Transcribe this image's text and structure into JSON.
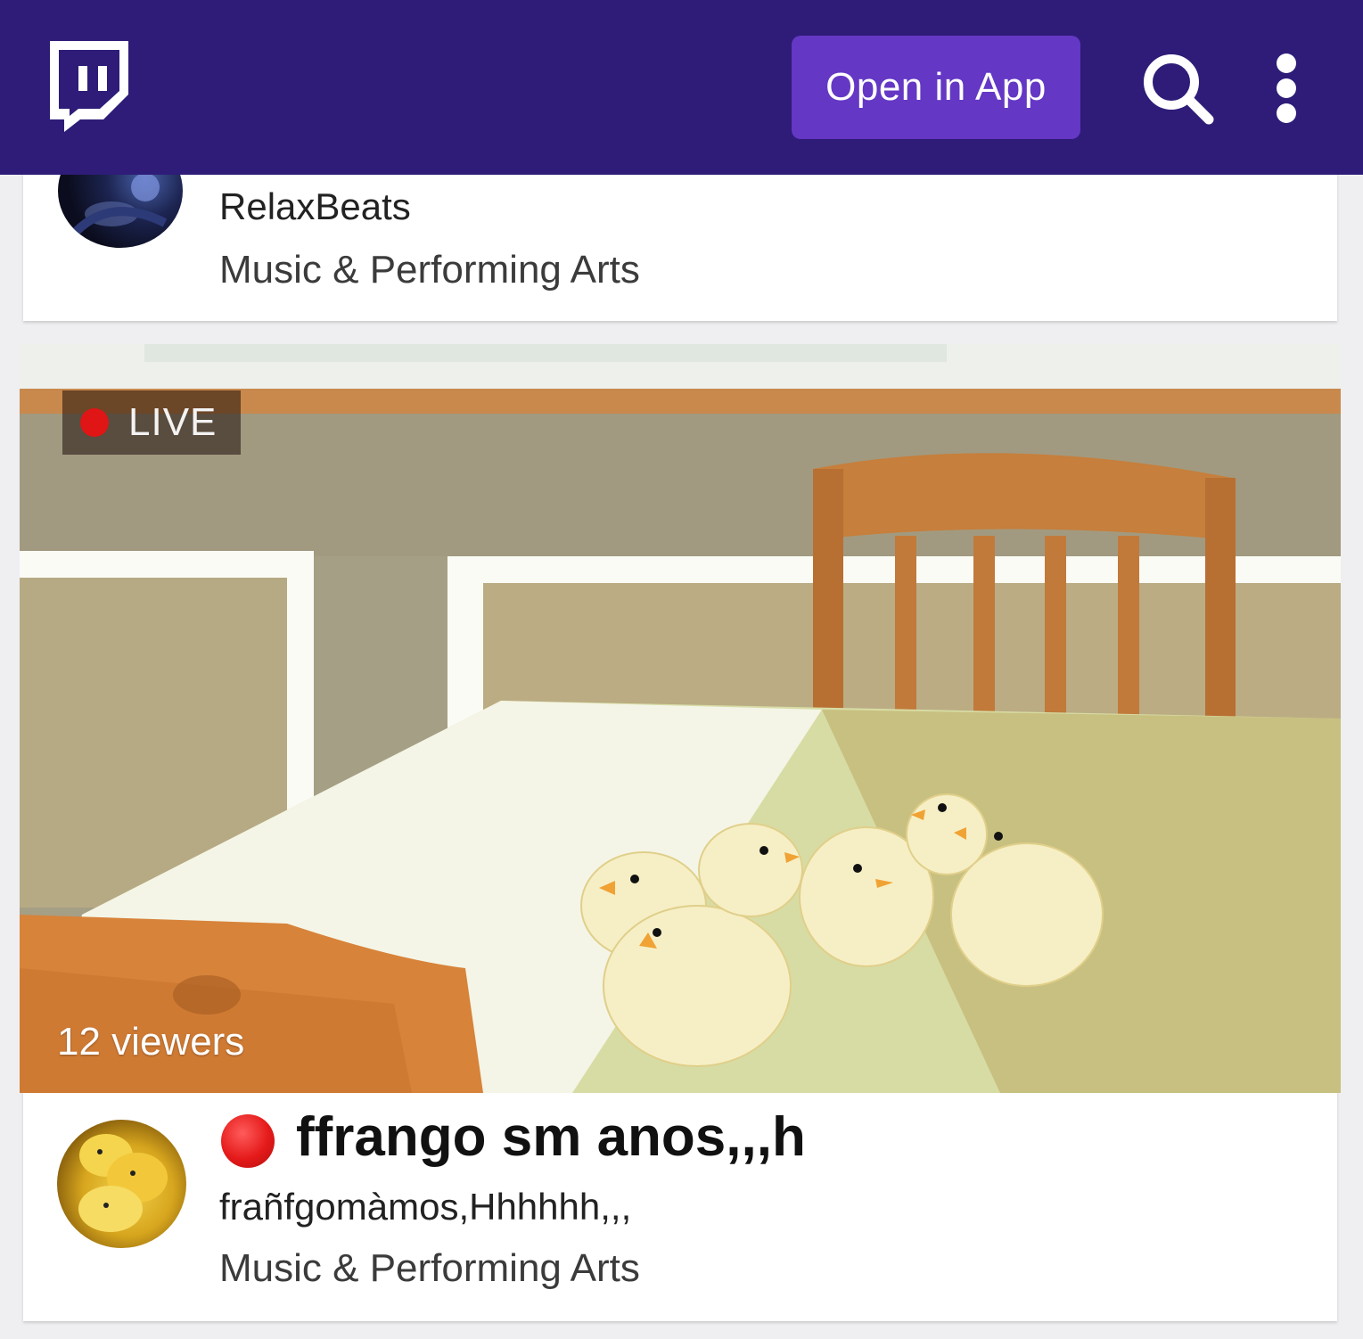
{
  "header": {
    "logo_icon": "twitch-logo-icon",
    "open_app_label": "Open in App",
    "search_icon": "search-icon",
    "menu_icon": "more-vertical-icon",
    "bar_color": "#2e1c78",
    "button_color": "#6437c4"
  },
  "streams": [
    {
      "channel_name": "RelaxBeats",
      "category": "Music & Performing Arts"
    },
    {
      "live_label": "LIVE",
      "viewers_label": "12 viewers",
      "title": "ffrango sm anos,,,h",
      "channel_name": "frañfgomàmos,Hhhhhh,,,",
      "category": "Music & Performing Arts",
      "live_color": "#e01515"
    }
  ]
}
